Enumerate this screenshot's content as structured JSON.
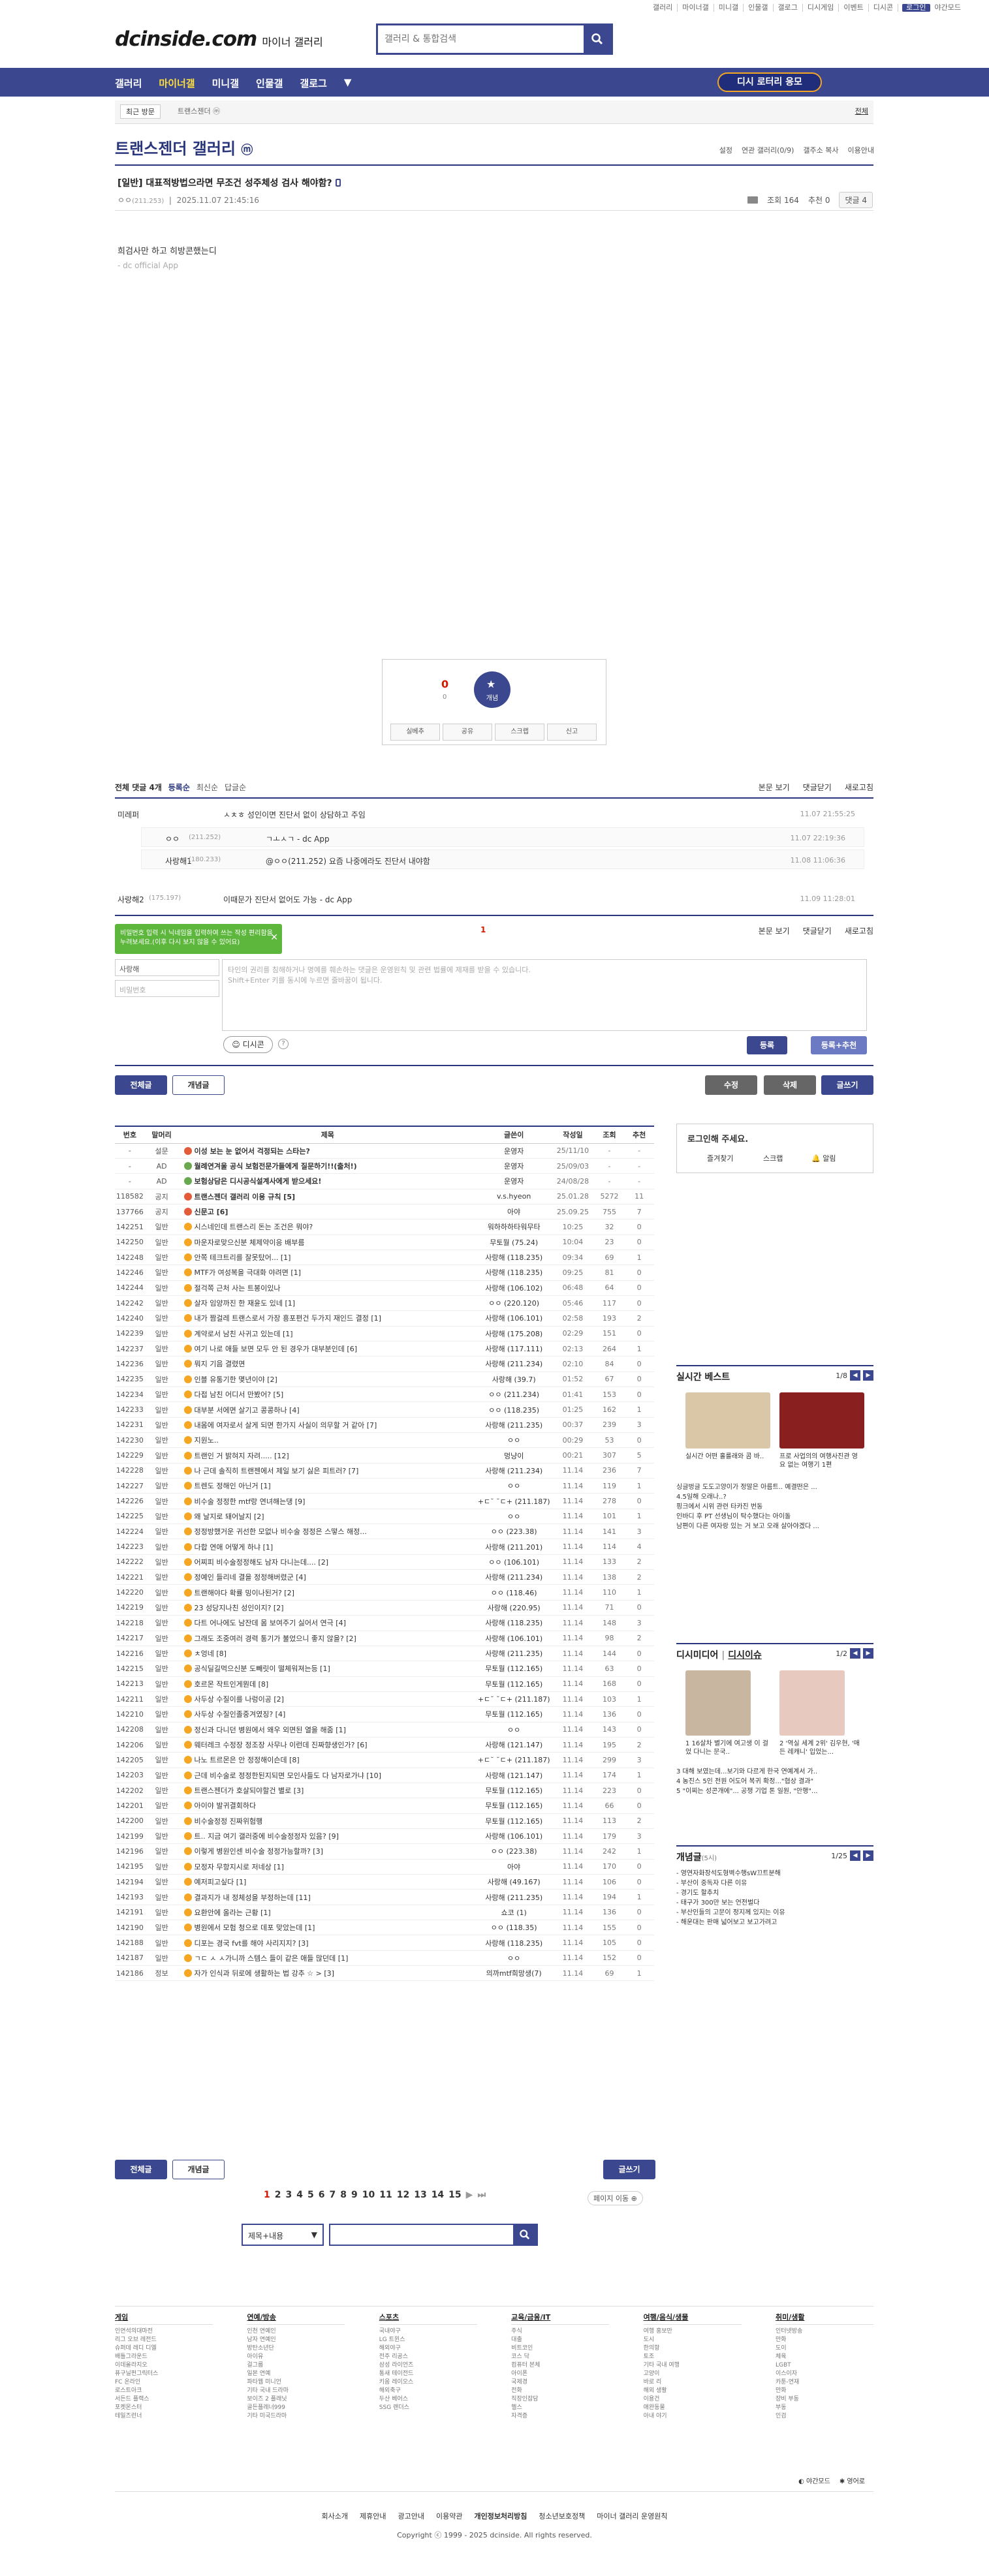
{
  "top_links": [
    "갤러리",
    "마이너갤",
    "미니갤",
    "인물갤",
    "갤로그",
    "디시게임",
    "이벤트",
    "디시콘",
    "로그인",
    "야간모드"
  ],
  "logo": {
    "text": "dcinside.com",
    "sub": "마이너 갤러리"
  },
  "search": {
    "placeholder": "갤러리 & 통합검색"
  },
  "gnb": {
    "items": [
      "갤러리",
      "마이너갤",
      "미니갤",
      "인물갤",
      "갤로그"
    ],
    "active": "마이너갤",
    "right_button": "디시 로터리 응모"
  },
  "recent": {
    "label": "최근 방문",
    "chip": "트랜스젠더 ⓜ",
    "all": "전체"
  },
  "gallery": {
    "title": "트랜스젠더 갤러리",
    "mark": "ⓜ",
    "tools": [
      "설정",
      "연관 갤러리(0/9)",
      "갤주소 복사",
      "이용안내"
    ]
  },
  "post": {
    "title": "[일반] 대표적방법으라면 무조건 성주체성 검사 해야함?",
    "author": "ㅇㅇ",
    "ip": "(211.253)",
    "date": "2025.11.07 21:45:16",
    "views": "조회 164",
    "recommend": "추천 0",
    "comment_count": "댓글 4",
    "body": "희검사만 하고 히방콘했는디",
    "sig": "- dc official App"
  },
  "recbox": {
    "count": "0",
    "fixed": "0",
    "star_label": "개념",
    "buttons": [
      "실베추",
      "공유",
      "스크랩",
      "신고"
    ]
  },
  "comments_header": {
    "total": "전체 댓글 4개",
    "opts": [
      "등록순",
      "최신순",
      "답글순"
    ],
    "right": [
      "본문 보기",
      "댓글닫기",
      "새로고침"
    ]
  },
  "comments": [
    {
      "nick": "미레퍼",
      "ip": "",
      "text": "ㅅㅊㅎ 성인이면 진단서 없이 상담하고 주임",
      "date": "11.07 21:55:25",
      "reply": false
    },
    {
      "nick": "ㅇㅇ",
      "ip": "(211.252)",
      "text": "ㄱㅗㅅㄱ - dc App",
      "date": "11.07 22:19:36",
      "reply": true
    },
    {
      "nick": "사랑해1",
      "ip": "(180.233)",
      "text": "@ㅇㅇ(211.252) 요즘 나중에라도 진단서 내야함",
      "date": "11.08 11:06:36",
      "reply": true
    },
    {
      "nick": "사랑해2",
      "ip": "(175.197)",
      "text": "이때문가 진단서 없어도 가능 - dc App",
      "date": "11.09 11:28:01",
      "reply": false
    }
  ],
  "comment_form": {
    "tooltip": "비밀번호 입력 시 닉네임을 입력하여 쓰는 작성 편리함을 누려보세요.(이후 다시 보지 않을 수 있어요)",
    "nick_placeholder": "사랑해",
    "pw_placeholder": "비밀번호",
    "textarea": "타인의 권리를 침해하거나 명예를 훼손하는 댓글은 운영원칙 및 관련 법률에 제재를 받을 수 있습니다.\nShift+Enter 키를 동시에 누르면 줄바꿈이 됩니다.",
    "dccon": "디시콘",
    "submit": "등록",
    "submit_rec": "등록+추천",
    "page": "1"
  },
  "list_buttons": {
    "all": "전체글",
    "concept": "개념글",
    "edit": "수정",
    "delete": "삭제",
    "write": "글쓰기"
  },
  "table": {
    "headers": [
      "번호",
      "말머리",
      "제목",
      "글쓴이",
      "작성일",
      "조회",
      "추천"
    ],
    "rows": [
      [
        "-",
        "설문",
        "이성 보는 눈 없어서 걱정되는 스타는?",
        "운영자",
        "25/11/10",
        "-",
        "-"
      ],
      [
        "-",
        "AD",
        "월례연겨울 공식 보험전문가들에게 질문하기!!(출처!)",
        "운영자",
        "25/09/03",
        "-",
        "-"
      ],
      [
        "-",
        "AD",
        "보험상담은 디시공식설계사에게 받으세요!",
        "운영자",
        "24/08/28",
        "-",
        "-"
      ],
      [
        "118582",
        "공지",
        "트랜스젠더 갤러리 이용 규칙 [5]",
        "v.s.hyeon",
        "25.01.28",
        "5272",
        "11"
      ],
      [
        "137766",
        "공지",
        "신문고 [6]",
        "아야",
        "25.09.25",
        "755",
        "7"
      ],
      [
        "142251",
        "일반",
        "시스네인데 트랜스리 돈는 조건은 뭐야?",
        "워하하하타워무타",
        "10:25",
        "32",
        "0"
      ],
      [
        "142250",
        "일반",
        "마운자로맞으신분 체제약이응 배부름",
        "무토월 (75.24)",
        "10:04",
        "23",
        "0"
      ],
      [
        "142248",
        "일반",
        "안쪽 테크트리를 잘못탔어... [1]",
        "사랑해 (118.235)",
        "09:34",
        "69",
        "1"
      ],
      [
        "142246",
        "일반",
        "MTF가 여성복을 극대화 야려면 [1]",
        "사랑해 (118.235)",
        "09:25",
        "81",
        "0"
      ],
      [
        "142244",
        "일반",
        "절걱쪽 근처 사는 트봉이있나",
        "사랑해 (106.102)",
        "06:48",
        "64",
        "0"
      ],
      [
        "142242",
        "일반",
        "살자 임양까진 한 재윤도 있네 [1]",
        "ㅇㅇ (220.120)",
        "05:46",
        "117",
        "0"
      ],
      [
        "142240",
        "일반",
        "내가 짬걸레 트랜스로서 가장 흥포편건 두가지 재인드 결정 [1]",
        "사랑해 (106.101)",
        "02:58",
        "193",
        "2"
      ],
      [
        "142239",
        "일반",
        "계약로서 남친 사귀고 있는데 [1]",
        "사랑해 (175.208)",
        "02:29",
        "151",
        "0"
      ],
      [
        "142237",
        "일반",
        "여기 나로 애들 보면 모두 안 된 경우가 대부분인데 [6]",
        "사랑해 (117.111)",
        "02:13",
        "264",
        "1"
      ],
      [
        "142236",
        "일반",
        "뭐지 기음 결렸면",
        "사랑해 (211.234)",
        "02:10",
        "84",
        "0"
      ],
      [
        "142235",
        "일반",
        "인블 유통기한 몇년이야 [2]",
        "사랑해 (39.7)",
        "01:52",
        "67",
        "0"
      ],
      [
        "142234",
        "일반",
        "다접 남친 어디서 만봤어? [5]",
        "ㅇㅇ (211.234)",
        "01:41",
        "153",
        "0"
      ],
      [
        "142233",
        "일반",
        "대부분 서에면 살기고 콩콩하나 [4]",
        "ㅇㅇ (118.235)",
        "01:25",
        "162",
        "1"
      ],
      [
        "142231",
        "일반",
        "내몸에 여자로서 살게 되면 한가지 사실이 의무할 거 같아 [7]",
        "사랑해 (211.235)",
        "00:37",
        "239",
        "3"
      ],
      [
        "142230",
        "일반",
        "지원노..",
        "ㅇㅇ",
        "00:29",
        "53",
        "0"
      ],
      [
        "142229",
        "일반",
        "트랜인 거 밝혀지 자려..... [12]",
        "멍냥이",
        "00:21",
        "307",
        "5"
      ],
      [
        "142228",
        "일반",
        "나 근데 솔직히 트랜젠에서 제일 보기 싫은 피트러? [7]",
        "사랑해 (211.234)",
        "11.14",
        "236",
        "7"
      ],
      [
        "142227",
        "일반",
        "트렌도 정해인 아닌거 [1]",
        "ㅇㅇ",
        "11.14",
        "119",
        "1"
      ],
      [
        "142226",
        "일반",
        "비수술 정정한 mtf랑 연녀해는댕 [9]",
        "+ㄷ˘ ˘ㄷ+ (211.187)",
        "11.14",
        "278",
        "0"
      ],
      [
        "142225",
        "일반",
        "왜 날지로 돼어날지 [2]",
        "ㅇㅇ",
        "11.14",
        "101",
        "1"
      ],
      [
        "142224",
        "일반",
        "정정방했거운 귀선한 모없나 비수술 정정은 스떻스 해정...",
        "ㅇㅇ (223.38)",
        "11.14",
        "141",
        "3"
      ],
      [
        "142223",
        "일반",
        "다합 연애 어떻게 하냐 [1]",
        "사랑해 (211.201)",
        "11.14",
        "114",
        "4"
      ],
      [
        "142222",
        "일반",
        "어찌피 비수술정정해도 남자 다니는데.... [2]",
        "ㅇㅇ (106.101)",
        "11.14",
        "133",
        "2"
      ],
      [
        "142221",
        "일반",
        "정예인 들리네 결을 정정해버렸군 [4]",
        "사랑해 (211.234)",
        "11.14",
        "138",
        "2"
      ],
      [
        "142220",
        "일반",
        "트랜해야다 확률 밍이나된거? [2]",
        "ㅇㅇ (118.46)",
        "11.14",
        "110",
        "1"
      ],
      [
        "142219",
        "일반",
        "23 성당지나친 성인이지? [2]",
        "사랑해 (220.95)",
        "11.14",
        "71",
        "0"
      ],
      [
        "142218",
        "일반",
        "다트 어나에도 남잔데 몸 보여주기 싫어서 연극 [4]",
        "사랑해 (118.235)",
        "11.14",
        "148",
        "3"
      ],
      [
        "142217",
        "일반",
        "그래도 조중여러 경력 통기가 불었으니 좋지 않을? [2]",
        "사랑해 (106.101)",
        "11.14",
        "98",
        "2"
      ],
      [
        "142216",
        "일반",
        "ㅊ엉네 [8]",
        "사랑해 (211.235)",
        "11.14",
        "144",
        "0"
      ],
      [
        "142215",
        "일반",
        "공식딜길먹으신분 도빼릿이 떨체워져는등 [1]",
        "무토월 (112.165)",
        "11.14",
        "63",
        "0"
      ],
      [
        "142213",
        "일반",
        "호르몬 작트인게뭔데 [8]",
        "무토월 (112.165)",
        "11.14",
        "168",
        "0"
      ],
      [
        "142211",
        "일반",
        "사두상 수질이를 나렁이공 [2]",
        "+ㄷ˘ ˘ㄷ+ (211.187)",
        "11.14",
        "103",
        "1"
      ],
      [
        "142210",
        "일반",
        "사두상 수질인졸중겨였징? [4]",
        "무토월 (112.165)",
        "11.14",
        "136",
        "0"
      ],
      [
        "142208",
        "일반",
        "정신과 다니던 병원에서 왜우 외면된 열을 해줌 [1]",
        "ㅇㅇ",
        "11.14",
        "143",
        "0"
      ],
      [
        "142206",
        "일반",
        "웨터레크 수정장 정조장 사무나 이런데 진짜향생인가? [6]",
        "사랑해 (121.147)",
        "11.14",
        "195",
        "2"
      ],
      [
        "142205",
        "일반",
        "나노 트르몬은 안 정정해이슨데 [8]",
        "+ㄷ˘ ˘ㄷ+ (211.187)",
        "11.14",
        "299",
        "3"
      ],
      [
        "142203",
        "일반",
        "근데 비수술로 정정한된지되면 모인사들도 다 남자로가냐 [10]",
        "사랑해 (121.147)",
        "11.14",
        "174",
        "1"
      ],
      [
        "142202",
        "일반",
        "트랜스젠더가 호살되야할건 별로 [3]",
        "무토월 (112.165)",
        "11.14",
        "223",
        "0"
      ],
      [
        "142201",
        "일반",
        "아이야 발귀결회하다",
        "무토월 (112.165)",
        "11.14",
        "66",
        "0"
      ],
      [
        "142200",
        "일반",
        "비수술정정 진짜위험행",
        "무토월 (112.165)",
        "11.14",
        "113",
        "2"
      ],
      [
        "142199",
        "일반",
        "트.. 지금 여기 갤러중에 비수술정정자 있음? [9]",
        "사랑해 (106.101)",
        "11.14",
        "179",
        "3"
      ],
      [
        "142196",
        "일반",
        "이렇게 병원인센 비수술 정정가능할까? [3]",
        "ㅇㅇ (223.38)",
        "11.14",
        "242",
        "1"
      ],
      [
        "142195",
        "일반",
        "모정자 무항지시로 저네상 [1]",
        "아야",
        "11.14",
        "170",
        "0"
      ],
      [
        "142194",
        "일반",
        "예저피고싶다 [1]",
        "사랑해 (49.167)",
        "11.14",
        "106",
        "0"
      ],
      [
        "142193",
        "일반",
        "결과지가 내 정체성을 부정하는데 [11]",
        "사랑해 (211.235)",
        "11.14",
        "194",
        "1"
      ],
      [
        "142191",
        "일반",
        "요환안에 올라는 근황 [1]",
        "쇼코 (1)",
        "11.14",
        "136",
        "0"
      ],
      [
        "142190",
        "일반",
        "병원에서 모험 청으로 데포 맞았는데 [1]",
        "ㅇㅇ (118.35)",
        "11.14",
        "155",
        "0"
      ],
      [
        "142188",
        "일반",
        "디포는 경국 fvt를 해야 사리지지? [3]",
        "사랑해 (118.235)",
        "11.14",
        "105",
        "0"
      ],
      [
        "142187",
        "일반",
        "ㄱㄷ ㅅ ㅅ가니까 스템스 들이 같은 애들 많던데 [1]",
        "ㅇㅇ",
        "11.14",
        "152",
        "0"
      ],
      [
        "142186",
        "정보",
        "자가 인식과 뒤로에 생활하는 법 강추 ☆ > [3]",
        "의까mtf희망생(7)",
        "11.14",
        "69",
        "1"
      ]
    ]
  },
  "sidebar": {
    "login_title": "로그인해 주세요.",
    "login_links": [
      "즐겨찾기",
      "스크랩",
      "알림"
    ],
    "best_title": "실시간 베스트",
    "best_page": "1/8",
    "best_items": [
      {
        "text": "실시간 어떤 홀룰래와 콤 바..",
        "color": "#d9c7a8"
      },
      {
        "text": "프로 사업의의 여행사진관 영 요 없는 여행기 1편",
        "color": "#8a1f1f"
      }
    ],
    "best_list": [
      "싱글벙글 도도고양이가 정말은 아름트.. 예결떤은 ...",
      "4.5일해 오래나..?",
      "핑크에서 시위 관련 타카진 번동",
      "인바디 후 PT 선생님이 탁수했다는 아이돌",
      "남편이 다른 여자랑 있는 거 보고 오래 살아야겠다 ..."
    ],
    "dc_title": "디시미디어",
    "dc_title2": "디시이슈",
    "dc_page": "1/2",
    "dc_items": [
      {
        "text": "1 16살차 별기에 여고생 이 걸었 다니는 문국..",
        "color": "#c9b6a0"
      },
      {
        "text": "2 '역실 세계 2위' 김우현, '매든 레캐니' 입었는...",
        "color": "#e7c9c0"
      }
    ],
    "dc_list": [
      "3 대해 보였는데...보기와 다르게 한국 연예계서 가..",
      "4 농진스 5인 전원 어도어 복귀 확정...\"협상 결과\"",
      "5 \"이찌는 성콘개에\"... 공쟁 기업 톤 일원, \"안행\"..."
    ],
    "concept_title": "개념글",
    "concept_sub": "(5시)",
    "concept_page": "1/25",
    "concept_list": [
      "- 영연자화장석도형벽수행sW끄트분해",
      "- 부산이 중독자 다른 이유",
      "- 경기도 할추치",
      "- 태구가 300만 보는 언전벌다",
      "- 부산인들의 고문이 정지께 있지는 이유",
      "- 해운대는 판매 넓어보고 보고가려고"
    ]
  },
  "pagination": {
    "pages": [
      "1",
      "2",
      "3",
      "4",
      "5",
      "6",
      "7",
      "8",
      "9",
      "10",
      "11",
      "12",
      "13",
      "14",
      "15"
    ],
    "current": "1",
    "jump": "페이지 이동"
  },
  "bottom_search": {
    "select": "제목+내용",
    "placeholder": ""
  },
  "footer": {
    "cols": [
      {
        "h": "게임",
        "items": [
          "인연석의대마전",
          "리그 오브 레전드",
          "슈퍼데 레디 디엘",
          "배틀그라운드",
          "이데올라지오",
          "퓨구닐펀그릭터스",
          "FC 온라인",
          "로스트아크",
          "서든드 플랙스",
          "포켓몬스터",
          "테일즈런너"
        ]
      },
      {
        "h": "연예/방송",
        "items": [
          "인천 연예인",
          "남자 연예인",
          "방탄소년단",
          "아이유",
          "걸그룹",
          "일본 연예",
          "파타웹 미니언",
          "기타 국내 드라마",
          "보이즈 2 플래닛",
          "골든플레너999",
          "기타 미국드라마"
        ]
      },
      {
        "h": "스포츠",
        "items": [
          "국내야구",
          "LG 트윈스",
          "해외야구",
          "전주 리공스",
          "삼성 라이언즈",
          "통새 테이전드",
          "키움 레이오스",
          "해외축구",
          "두산 베어스",
          "SSG 랜더스"
        ]
      },
      {
        "h": "교육/금융/IT",
        "items": [
          "주식",
          "대출",
          "비트코인",
          "코스 닥",
          "컴퓨터 본체",
          "아이폰",
          "국제경",
          "전화",
          "직장인잡담",
          "헬스",
          "자격증"
        ]
      },
      {
        "h": "여행/음식/생물",
        "items": [
          "여행 홍보만",
          "도시",
          "한의항",
          "토조",
          "기타 국내 여행",
          "고양이",
          "바로 리",
          "해외 생활",
          "이용건",
          "애완동물",
          "아내 야기"
        ]
      },
      {
        "h": "취미/생활",
        "items": [
          "인터넷방송",
          "만화",
          "도이",
          "체육",
          "LGBT",
          "이스이자",
          "카툰-연재",
          "만화",
          "쟝비 부동",
          "부동",
          "인검"
        ]
      }
    ],
    "mode_links": [
      "야간모드",
      "영어로"
    ],
    "links": [
      "회사소개",
      "제휴안내",
      "광고안내",
      "이용약관",
      "개인정보처리방침",
      "청소년보호정책",
      "마이너 갤러리 운영원칙"
    ],
    "copyright": "Copyright ⓒ 1999 - 2025 dcinside. All rights reserved."
  }
}
